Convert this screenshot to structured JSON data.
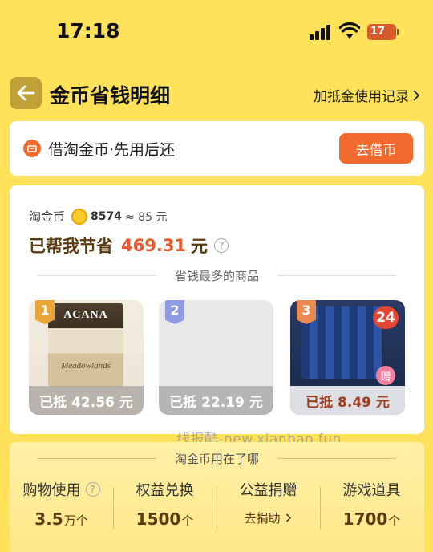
{
  "status": {
    "time": "17:18",
    "battery": "17"
  },
  "header": {
    "title": "金币省钱明细",
    "records_link": "加抵金使用记录"
  },
  "borrow": {
    "text": "借淘金币·先用后还",
    "button": "去借币"
  },
  "savings": {
    "coin_label": "淘金币",
    "coin_count": "8574",
    "coin_approx": "≈ 85 元",
    "saved_prefix": "已帮我节省",
    "saved_amount": "469.31",
    "saved_unit": "元",
    "top_products_title": "省钱最多的商品",
    "products": [
      {
        "rank": "1",
        "deduction": "已抵 42.56 元",
        "badge_color": "#e9a43a"
      },
      {
        "rank": "2",
        "deduction": "已抵 22.19 元",
        "badge_color": "#8e9be3"
      },
      {
        "rank": "3",
        "deduction": "已抵 8.49 元",
        "badge_color": "#e98a50"
      }
    ],
    "product1_brand": "ACANA",
    "product1_name": "Meadowlands",
    "product3_tag": "24",
    "product3_gift": "赠"
  },
  "watermark": "线报酷-new.xianbao.fun",
  "usage": {
    "title": "淘金币用在了哪",
    "items": [
      {
        "label": "购物使用",
        "value": "3.5",
        "unit": "万个"
      },
      {
        "label": "权益兑换",
        "value": "1500",
        "unit": "个"
      },
      {
        "label": "公益捐赠",
        "sub": "去捐助"
      },
      {
        "label": "游戏道具",
        "value": "1700",
        "unit": "个"
      }
    ]
  }
}
